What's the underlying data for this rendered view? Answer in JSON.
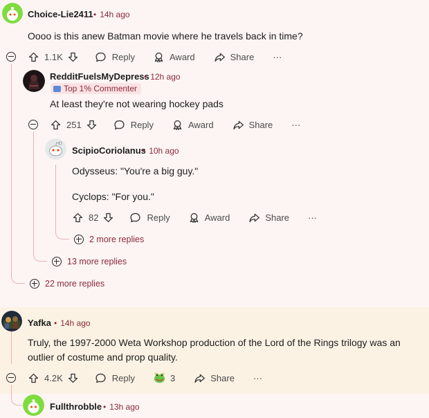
{
  "comments": [
    {
      "username": "Choice-Lie2411",
      "time": "14h ago",
      "text": "Oooo is this anew Batman movie where he travels back in time?",
      "votes": "1.1K",
      "reply": "Reply",
      "award": "Award",
      "share": "Share",
      "more_replies": "22 more replies"
    },
    {
      "username": "RedditFuelsMyDepress",
      "time": "12h ago",
      "flair": "Top 1% Commenter",
      "text": "At least they're not wearing hockey pads",
      "votes": "251",
      "reply": "Reply",
      "award": "Award",
      "share": "Share",
      "more_replies": "13 more replies"
    },
    {
      "username": "ScipioCoriolanus",
      "time": "10h ago",
      "text_line1": "Odysseus: \"You're a big guy.\"",
      "text_line2": "Cyclops: \"For you.\"",
      "votes": "82",
      "reply": "Reply",
      "award": "Award",
      "share": "Share",
      "more_replies": "2 more replies"
    },
    {
      "username": "Yafka",
      "time": "14h ago",
      "text": "Truly, the 1997-2000 Weta Workshop production of the Lord of the Rings trilogy was an outlier of costume and prop quality.",
      "votes": "4.2K",
      "reply": "Reply",
      "award_count": "3",
      "share": "Share"
    },
    {
      "username": "Fullthrobble",
      "time": "13h ago"
    }
  ],
  "ellipsis": "···",
  "separator": "•",
  "colors": {
    "background": "#fdf5f4",
    "meta": "#8a2a3a",
    "thread_line": "#e3b3b6",
    "highlight": "#fcf2e4"
  },
  "icons": [
    "upvote-icon",
    "downvote-icon",
    "reply-icon",
    "award-icon",
    "share-icon",
    "overflow-icon",
    "collapse-icon",
    "expand-icon"
  ]
}
